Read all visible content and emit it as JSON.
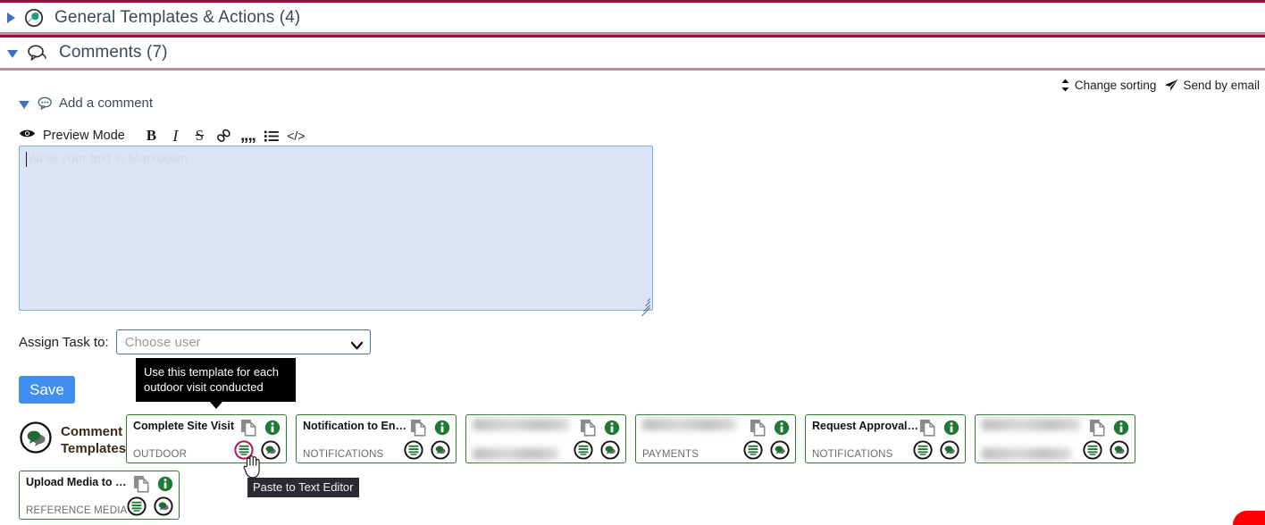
{
  "sections": [
    {
      "title": "General Templates & Actions (4)",
      "expanded": false,
      "icon": "target-circle-icon"
    },
    {
      "title": "Comments (7)",
      "expanded": true,
      "icon": "comment-bubble-icon"
    }
  ],
  "top_actions": [
    {
      "label": "Change sorting",
      "icon": "sort-updown-icon"
    },
    {
      "label": "Send by email",
      "icon": "paper-plane-icon"
    }
  ],
  "add_comment": {
    "label": "Add a comment",
    "icon": "comment-bubble-icon",
    "expanded": true
  },
  "editor": {
    "preview_mode_label": "Preview Mode",
    "preview_icon": "eye-icon",
    "toolbar": [
      {
        "name": "bold",
        "glyph": "B"
      },
      {
        "name": "italic",
        "glyph": "I"
      },
      {
        "name": "strikethrough",
        "glyph": "S"
      },
      {
        "name": "link",
        "glyph": "⚗"
      },
      {
        "name": "quote",
        "glyph": "””"
      },
      {
        "name": "bullet-list",
        "glyph": "☰"
      },
      {
        "name": "code",
        "glyph": "</>"
      }
    ],
    "placeholder": "Write your text in Markdown",
    "value": ""
  },
  "assign": {
    "label": "Assign Task to:",
    "selected": "Choose user",
    "options": [
      "Choose user"
    ]
  },
  "save_label": "Save",
  "tooltips": {
    "template_hint": "Use this template for each outdoor visit conducted",
    "paste_hint": "Paste to Text Editor"
  },
  "comment_templates": {
    "label_line1": "Comment",
    "label_line2": "Templates",
    "icon": "comment-templates-icon",
    "card_icons": {
      "copy": "copy-icon",
      "info": "info-icon",
      "paste_text": "paste-to-text-editor-icon",
      "paste_comment": "paste-to-comment-icon"
    },
    "cards": [
      {
        "title": "Complete Site Visit",
        "category": "OUTDOOR",
        "blurred": false,
        "active_icon": "paste_text"
      },
      {
        "title": "Notification to En…",
        "category": "NOTIFICATIONS",
        "blurred": false,
        "active_icon": null
      },
      {
        "title": "",
        "category": "",
        "blurred": true,
        "active_icon": null
      },
      {
        "title": "",
        "category": "PAYMENTS",
        "blurred": true,
        "active_icon": null
      },
      {
        "title": "Request Approval…",
        "category": "NOTIFICATIONS",
        "blurred": false,
        "active_icon": null
      },
      {
        "title": "",
        "category": "",
        "blurred": true,
        "active_icon": null
      },
      {
        "title": "Upload Media to …",
        "category": "REFERENCE MEDIA",
        "blurred": false,
        "active_icon": null
      }
    ]
  },
  "colors": {
    "section_top_border": "#9b0b38",
    "section_bottom_border": "#b98ca0",
    "accent_blue": "#3f8ef0",
    "card_border_green": "#2e7d32",
    "active_icon": "#b5125c",
    "textarea_bg": "#dbe4f7"
  }
}
